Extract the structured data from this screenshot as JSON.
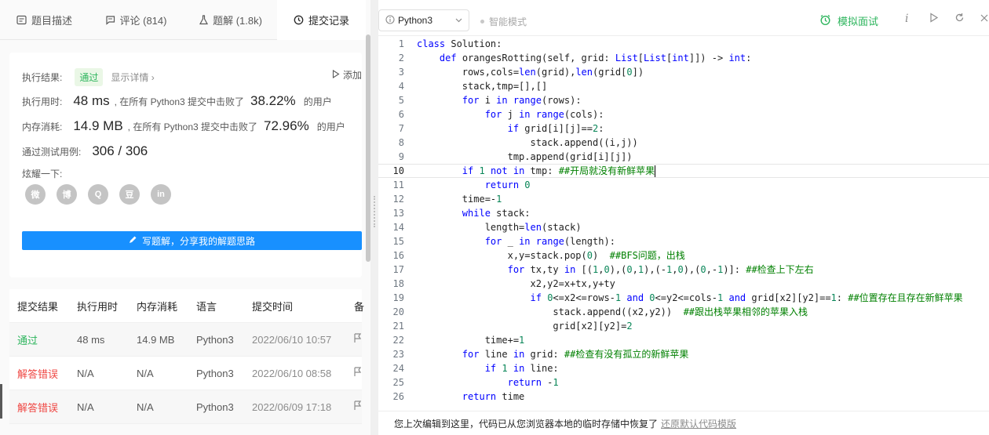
{
  "tabs": [
    {
      "label": "题目描述",
      "icon": "description-icon"
    },
    {
      "label": "评论 (814)",
      "icon": "comment-icon"
    },
    {
      "label": "题解 (1.8k)",
      "icon": "flask-icon"
    },
    {
      "label": "提交记录",
      "icon": "clock-icon"
    }
  ],
  "result": {
    "status_label": "执行结果:",
    "status_value": "通过",
    "detail_link": "显示详情",
    "add_link": "添加",
    "time_label": "执行用时:",
    "time_value": "48 ms",
    "time_beat_text": ", 在所有 Python3 提交中击败了",
    "time_pct": "38.22%",
    "time_suffix": "的用户",
    "mem_label": "内存消耗:",
    "mem_value": "14.9 MB",
    "mem_beat_text": ", 在所有 Python3 提交中击败了",
    "mem_pct": "72.96%",
    "mem_suffix": "的用户",
    "tests_label": "通过测试用例:",
    "tests_value": "306 / 306",
    "share_label": "炫耀一下:",
    "share_icons": [
      "wechat-icon",
      "weibo-icon",
      "qq-icon",
      "douban-icon",
      "linkedin-icon"
    ],
    "share_glyphs": [
      "微",
      "博",
      "Q",
      "豆",
      "in"
    ],
    "write_button": "写题解，分享我的解题思路"
  },
  "submissions": {
    "headers": [
      "提交结果",
      "执行用时",
      "内存消耗",
      "语言",
      "提交时间",
      "备"
    ],
    "rows": [
      {
        "result": "通过",
        "status": "ok",
        "time": "48 ms",
        "memory": "14.9 MB",
        "lang": "Python3",
        "date": "2022/06/10 10:57"
      },
      {
        "result": "解答错误",
        "status": "err",
        "time": "N/A",
        "memory": "N/A",
        "lang": "Python3",
        "date": "2022/06/10 08:58"
      },
      {
        "result": "解答错误",
        "status": "err",
        "time": "N/A",
        "memory": "N/A",
        "lang": "Python3",
        "date": "2022/06/09 17:18"
      }
    ]
  },
  "toolbar": {
    "language": "Python3",
    "smart_mode": "智能模式",
    "mock_interview": "模拟面试"
  },
  "code": {
    "current_line": 10,
    "lines": [
      "class Solution:",
      "    def orangesRotting(self, grid: List[List[int]]) -> int:",
      "        rows,cols=len(grid),len(grid[0])",
      "        stack,tmp=[],[]",
      "        for i in range(rows):",
      "            for j in range(cols):",
      "                if grid[i][j]==2:",
      "                    stack.append((i,j))",
      "                tmp.append(grid[i][j])",
      "        if 1 not in tmp: ##开局就没有新鲜苹果",
      "            return 0",
      "        time=-1",
      "        while stack:",
      "            length=len(stack)",
      "            for _ in range(length):",
      "                x,y=stack.pop(0)  ##BFS问题，出栈",
      "                for tx,ty in [(1,0),(0,1),(-1,0),(0,-1)]: ##检查上下左右",
      "                    x2,y2=x+tx,y+ty",
      "                    if 0<=x2<=rows-1 and 0<=y2<=cols-1 and grid[x2][y2]==1: ##位置存在且存在新鲜苹果",
      "                        stack.append((x2,y2))  ##跟出栈苹果相邻的苹果入栈",
      "                        grid[x2][y2]=2",
      "            time+=1",
      "        for line in grid: ##检查有没有孤立的新鲜苹果",
      "            if 1 in line:",
      "                return -1",
      "        return time"
    ]
  },
  "footer": {
    "message": "您上次编辑到这里，代码已从您浏览器本地的临时存储中恢复了",
    "restore_link": "还原默认代码模版"
  }
}
